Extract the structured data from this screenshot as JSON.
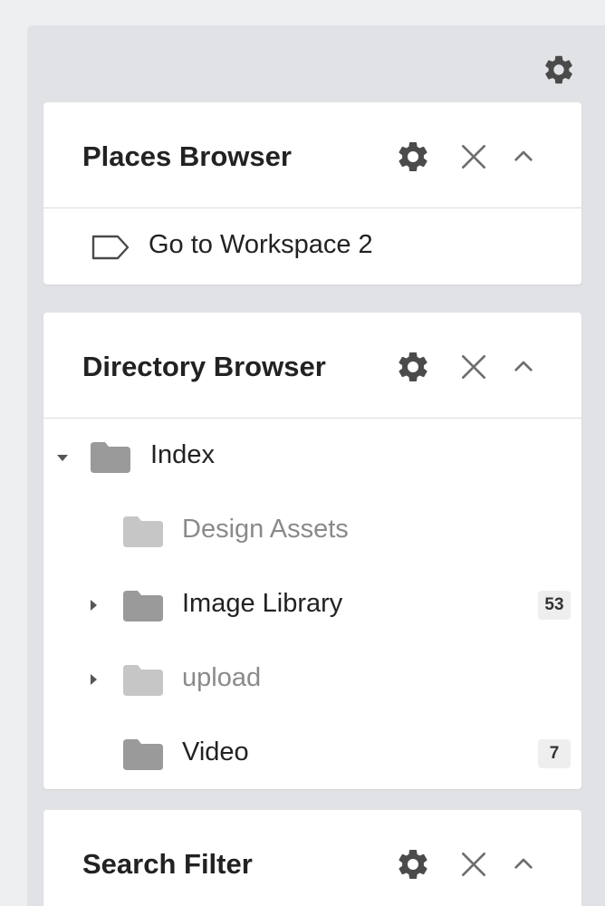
{
  "colors": {
    "folder_dark": "#9a9a9a",
    "folder_light": "#c6c6c6",
    "text_dark": "#222222",
    "text_muted": "#8a8a8a"
  },
  "sidebar": {
    "settings_icon": "gear-icon"
  },
  "places_browser": {
    "title": "Places Browser",
    "items": [
      {
        "label": "Go to Workspace 2",
        "icon": "tag-icon"
      }
    ]
  },
  "directory_browser": {
    "title": "Directory Browser",
    "items": [
      {
        "label": "Index",
        "expanded": true,
        "level": 0,
        "muted": false,
        "count": ""
      },
      {
        "label": "Design Assets",
        "level": 1,
        "muted": true,
        "count": ""
      },
      {
        "label": "Image Library",
        "level": 1,
        "expandable": true,
        "muted": false,
        "count": "53"
      },
      {
        "label": "upload",
        "level": 1,
        "expandable": true,
        "muted": true,
        "count": ""
      },
      {
        "label": "Video",
        "level": 1,
        "muted": false,
        "count": "7"
      }
    ]
  },
  "search_filter": {
    "title": "Search Filter"
  }
}
